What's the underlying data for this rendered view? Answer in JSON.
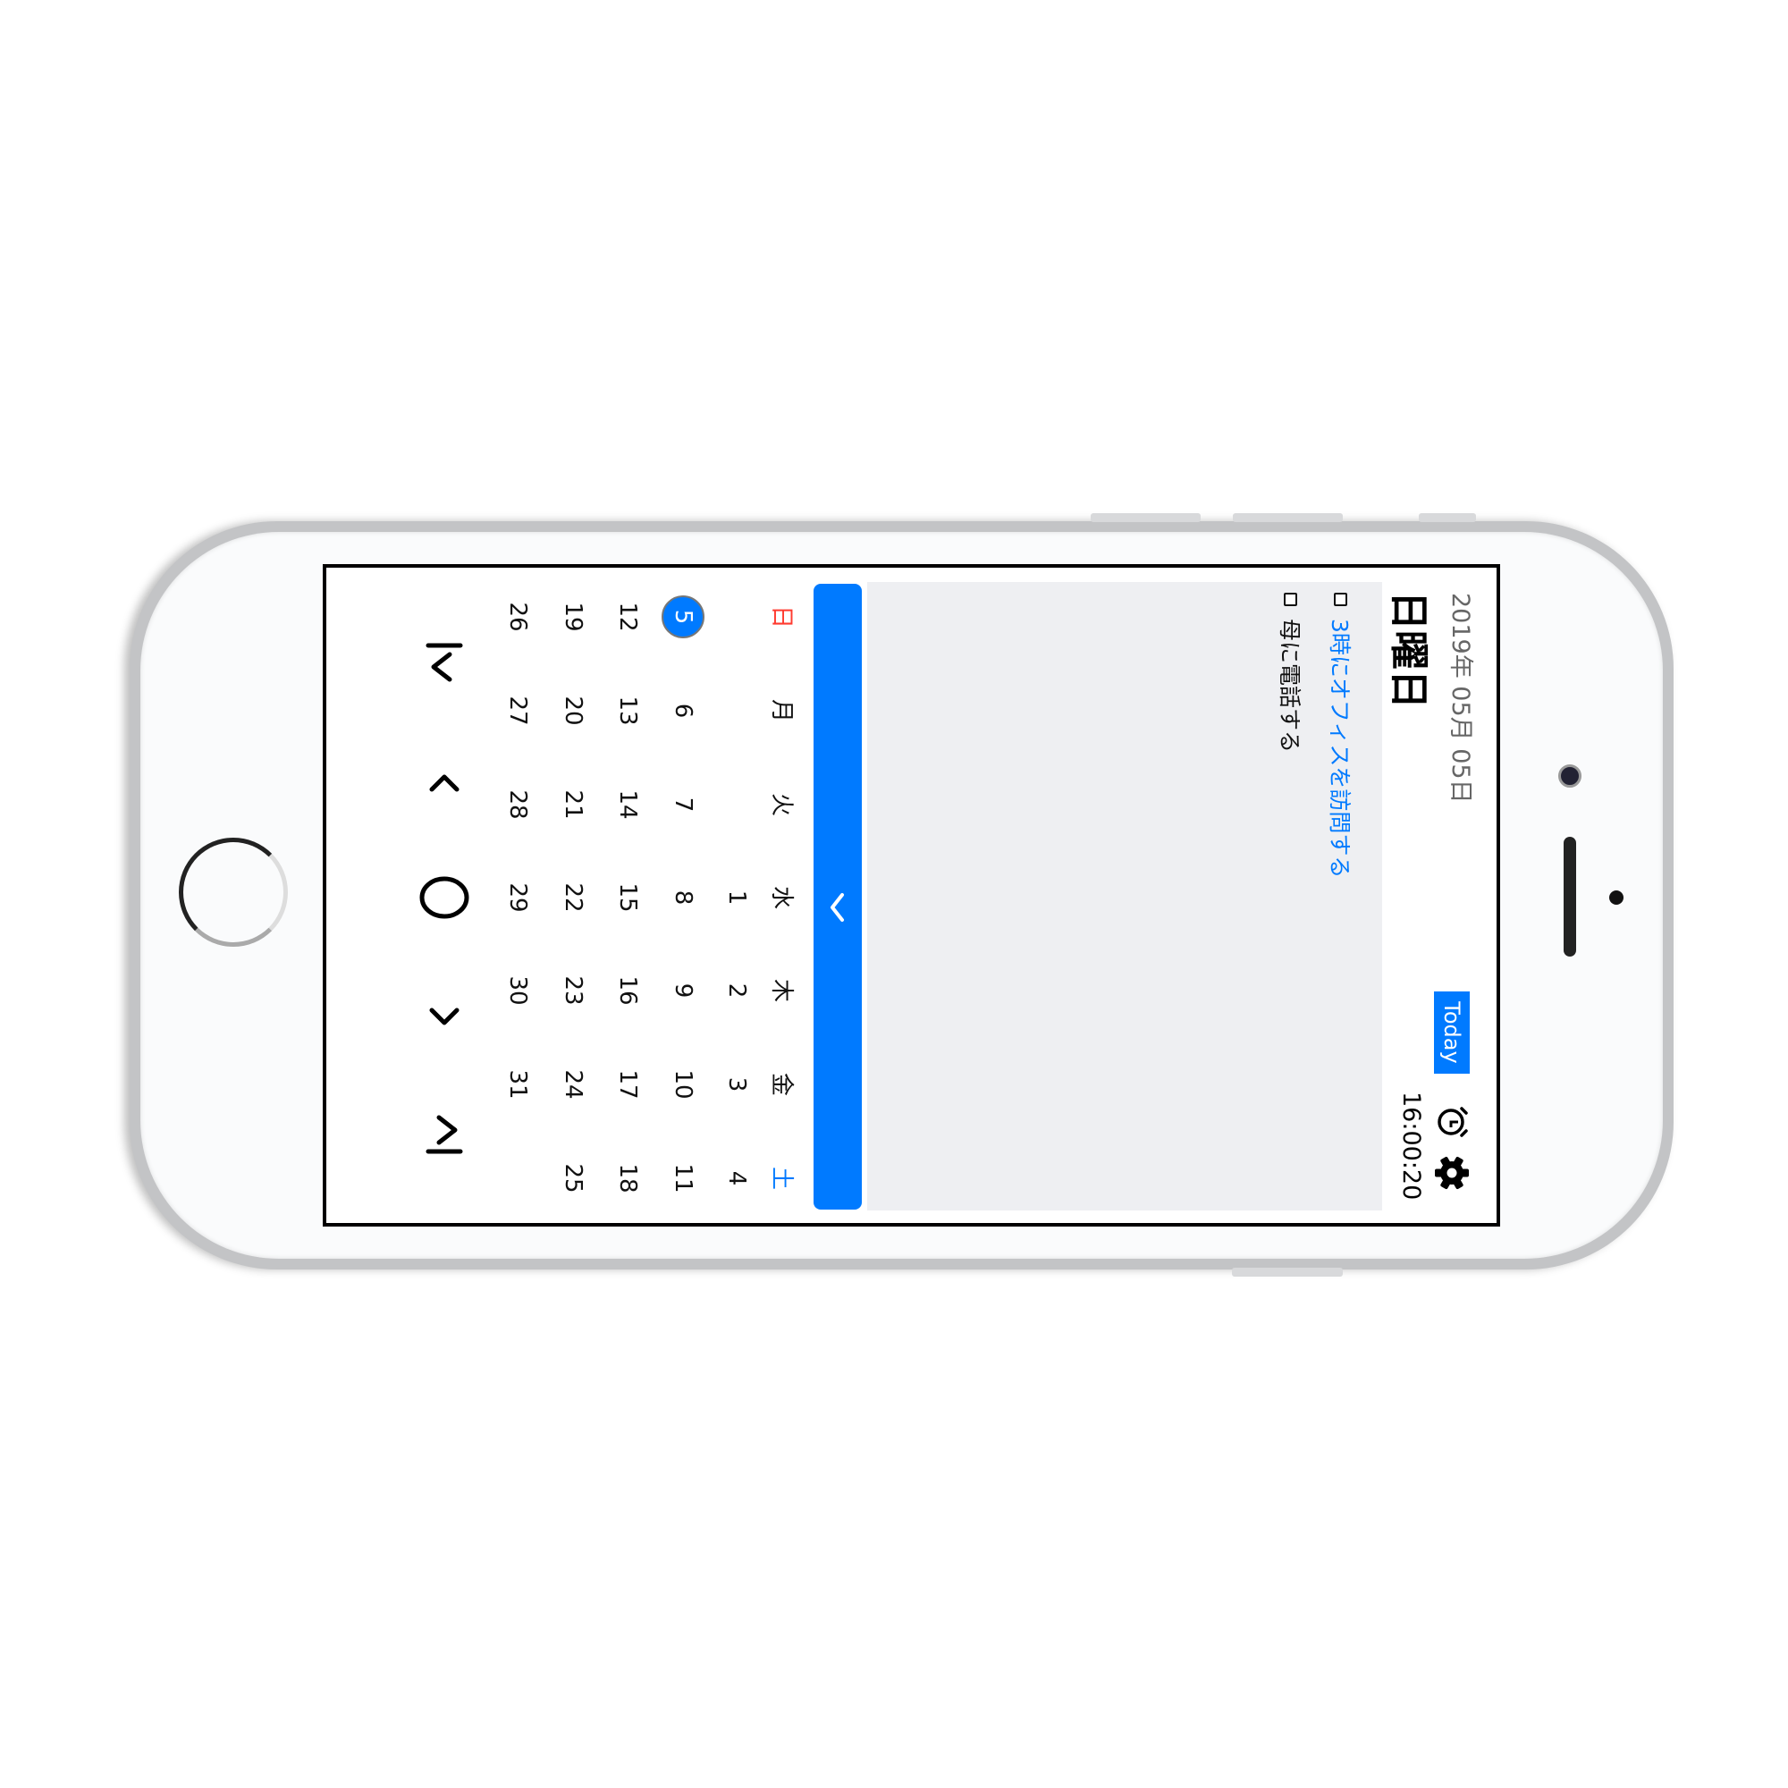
{
  "header": {
    "date": "2019年 05月 05日",
    "weekday": "日曜日",
    "today_button": "Today",
    "time": "16:00:20",
    "alarm_icon": "alarm-clock-icon",
    "settings_icon": "gear-icon"
  },
  "tasks": [
    {
      "label": "3時にオフィスを訪問する",
      "color": "#007aff",
      "checked": false
    },
    {
      "label": "母に電話する",
      "color": "#111111",
      "checked": false
    }
  ],
  "toggle_bar": {
    "icon": "chevron-left-icon",
    "color": "#007aff"
  },
  "calendar": {
    "weekdays": [
      "日",
      "月",
      "火",
      "水",
      "木",
      "金",
      "土"
    ],
    "weekday_colors": {
      "sunday": "#ff3b30",
      "saturday": "#007aff"
    },
    "selected_day": "5",
    "weeks": [
      [
        "",
        "",
        "",
        "1",
        "2",
        "3",
        "4"
      ],
      [
        "5",
        "6",
        "7",
        "8",
        "9",
        "10",
        "11"
      ],
      [
        "12",
        "13",
        "14",
        "15",
        "16",
        "17",
        "18"
      ],
      [
        "19",
        "20",
        "21",
        "22",
        "23",
        "24",
        "25"
      ],
      [
        "26",
        "27",
        "28",
        "29",
        "30",
        "31",
        ""
      ]
    ]
  },
  "navigation": {
    "icons": [
      "first-icon",
      "previous-icon",
      "current-icon",
      "next-icon",
      "last-icon"
    ]
  },
  "colors": {
    "accent": "#007aff",
    "panel": "#eeeff2"
  }
}
